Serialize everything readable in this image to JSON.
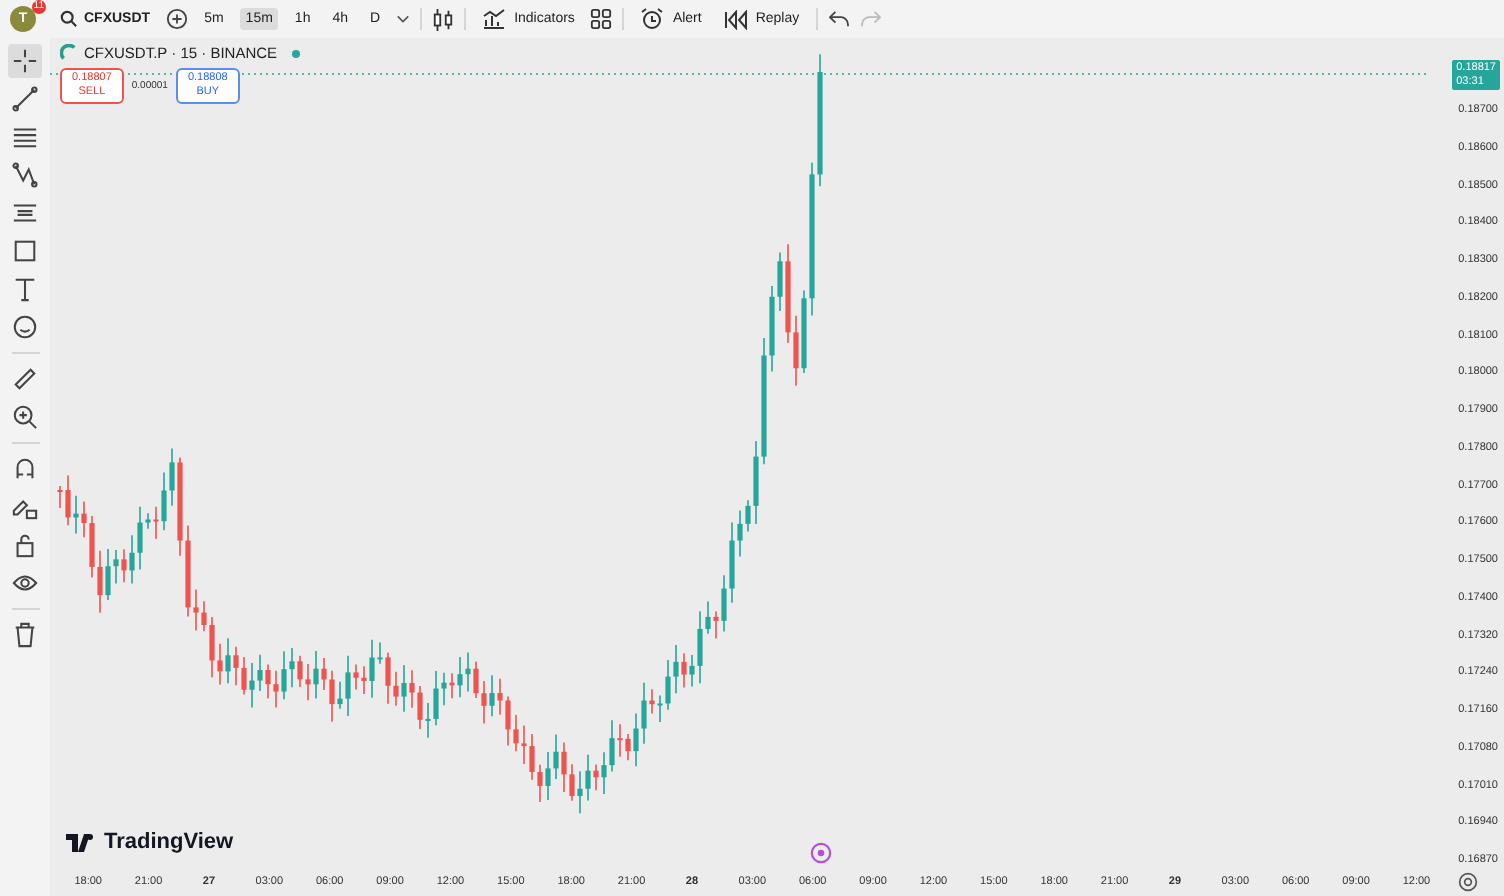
{
  "header": {
    "avatar": {
      "initial": "T",
      "badge": "11"
    },
    "symbol": "CFXUSDT",
    "intervals": [
      {
        "label": "5m",
        "selected": false
      },
      {
        "label": "15m",
        "selected": true
      },
      {
        "label": "1h",
        "selected": false
      },
      {
        "label": "4h",
        "selected": false
      },
      {
        "label": "D",
        "selected": false
      }
    ],
    "buttons": [
      {
        "kind": "indicators",
        "label": "Indicators"
      },
      {
        "kind": "templates"
      },
      {
        "kind": "alert",
        "label": "Alert"
      },
      {
        "kind": "replay",
        "label": "Replay"
      }
    ],
    "undo_disabled": false,
    "redo_disabled": true
  },
  "tool_groups": [
    [
      {
        "kind": "crosshair",
        "selected": true
      },
      {
        "kind": "trendline",
        "selected": false
      },
      {
        "kind": "fib",
        "selected": false
      },
      {
        "kind": "pattern",
        "selected": false
      },
      {
        "kind": "projection",
        "selected": false
      },
      {
        "kind": "rectangle",
        "selected": false
      },
      {
        "kind": "text",
        "selected": false
      },
      {
        "kind": "emoji",
        "selected": false
      }
    ],
    [
      {
        "kind": "ruler",
        "selected": false
      },
      {
        "kind": "zoom",
        "selected": false
      }
    ],
    [
      {
        "kind": "magnet",
        "selected": false
      },
      {
        "kind": "lockdraw",
        "selected": false
      },
      {
        "kind": "lock",
        "selected": false
      },
      {
        "kind": "eye",
        "selected": false
      }
    ],
    [
      {
        "kind": "trash",
        "selected": false
      }
    ]
  ],
  "legend": {
    "title": "CFXUSDT.P · 15 · BINANCE",
    "live": true,
    "sell": {
      "price": "0.18807",
      "label": "SELL"
    },
    "spread": "0.00001",
    "buy": {
      "price": "0.18808",
      "label": "BUY"
    }
  },
  "price_axis": {
    "last": {
      "price": "0.18817",
      "countdown": "03:31"
    },
    "labels": [
      "0.18700",
      "0.18600",
      "0.18500",
      "0.18400",
      "0.18300",
      "0.18200",
      "0.18100",
      "0.18000",
      "0.17900",
      "0.17800",
      "0.17700",
      "0.17600",
      "0.17500",
      "0.17400",
      "0.17320",
      "0.17240",
      "0.17160",
      "0.17080",
      "0.17010",
      "0.16940",
      "0.16870"
    ]
  },
  "time_axis": {
    "labels": [
      {
        "text": "18:00",
        "kind": "time"
      },
      {
        "text": "21:00",
        "kind": "time"
      },
      {
        "text": "27",
        "kind": "day"
      },
      {
        "text": "03:00",
        "kind": "time"
      },
      {
        "text": "06:00",
        "kind": "time"
      },
      {
        "text": "09:00",
        "kind": "time"
      },
      {
        "text": "12:00",
        "kind": "time"
      },
      {
        "text": "15:00",
        "kind": "time"
      },
      {
        "text": "18:00",
        "kind": "time"
      },
      {
        "text": "21:00",
        "kind": "time"
      },
      {
        "text": "28",
        "kind": "day"
      },
      {
        "text": "03:00",
        "kind": "time"
      },
      {
        "text": "06:00",
        "kind": "time"
      },
      {
        "text": "09:00",
        "kind": "time"
      },
      {
        "text": "12:00",
        "kind": "time"
      },
      {
        "text": "15:00",
        "kind": "time"
      },
      {
        "text": "18:00",
        "kind": "time"
      },
      {
        "text": "21:00",
        "kind": "time"
      },
      {
        "text": "29",
        "kind": "day"
      },
      {
        "text": "03:00",
        "kind": "time"
      },
      {
        "text": "06:00",
        "kind": "time"
      },
      {
        "text": "09:00",
        "kind": "time"
      },
      {
        "text": "12:00",
        "kind": "time"
      }
    ]
  },
  "logo": "TradingView"
}
